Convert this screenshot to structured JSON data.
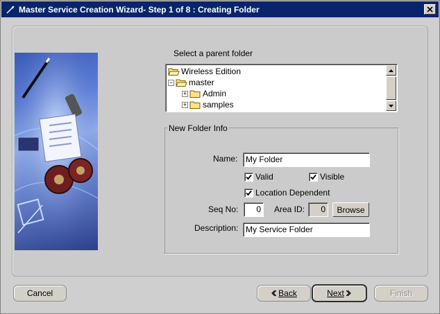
{
  "window": {
    "title": "Master Service Creation Wizard- Step 1 of 8 : Creating Folder",
    "title_bar_color": "#08256b"
  },
  "parent_folder": {
    "label": "Select a parent folder",
    "tree": [
      {
        "label": "Wireless Edition",
        "icon": "folder-open-icon"
      },
      {
        "label": "master",
        "icon": "folder-open-icon",
        "expander": "collapse"
      },
      {
        "label": "Admin",
        "icon": "folder-icon",
        "expander": "expand"
      },
      {
        "label": "samples",
        "icon": "folder-icon",
        "expander": "expand"
      }
    ]
  },
  "new_folder_info": {
    "group_label": "New Folder Info",
    "name_label": "Name:",
    "name_value": "My Folder",
    "valid_label": "Valid",
    "valid_checked": true,
    "visible_label": "Visible",
    "visible_checked": true,
    "location_dependent_label": "Location Dependent",
    "location_dependent_checked": true,
    "seq_no_label": "Seq No:",
    "seq_no_value": "0",
    "area_id_label": "Area ID:",
    "area_id_value": "0",
    "browse_label": "Browse",
    "description_label": "Description:",
    "description_value": "My Service Folder"
  },
  "footer": {
    "cancel_label": "Cancel",
    "back_label": "Back",
    "next_label": "Next",
    "finish_label": "Finish"
  }
}
